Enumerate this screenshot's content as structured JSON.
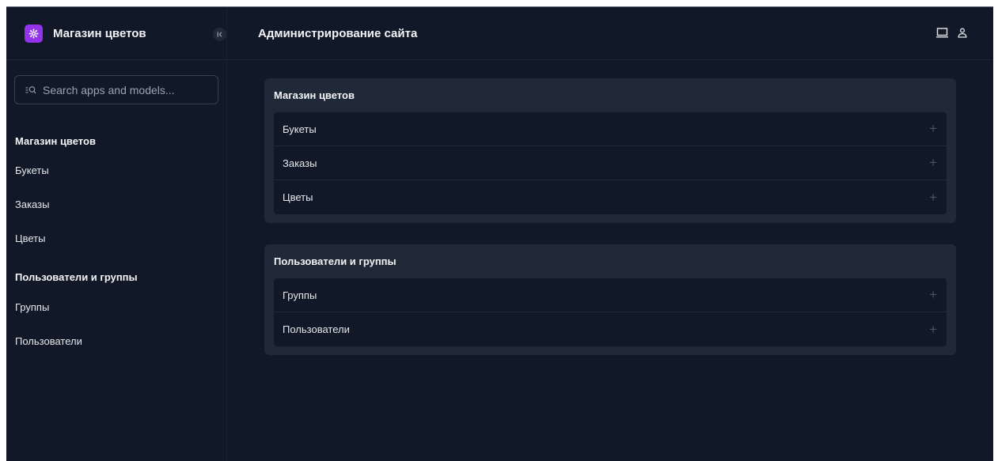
{
  "sidebar": {
    "brand": "Магазин цветов",
    "search_placeholder": "Search apps and models...",
    "groups": [
      {
        "title": "Магазин цветов",
        "items": [
          "Букеты",
          "Заказы",
          "Цветы"
        ]
      },
      {
        "title": "Пользователи и группы",
        "items": [
          "Группы",
          "Пользователи"
        ]
      }
    ]
  },
  "header": {
    "title": "Администрирование сайта"
  },
  "main": {
    "cards": [
      {
        "title": "Магазин цветов",
        "rows": [
          "Букеты",
          "Заказы",
          "Цветы"
        ]
      },
      {
        "title": "Пользователи и группы",
        "rows": [
          "Группы",
          "Пользователи"
        ]
      }
    ],
    "add_glyph": "+"
  },
  "colors": {
    "accent": "#9333ea",
    "background": "#111827",
    "card": "#1f2937"
  },
  "icons": [
    "settings-icon",
    "collapse-icon",
    "search-icon",
    "laptop-icon",
    "user-icon",
    "plus-icon"
  ]
}
